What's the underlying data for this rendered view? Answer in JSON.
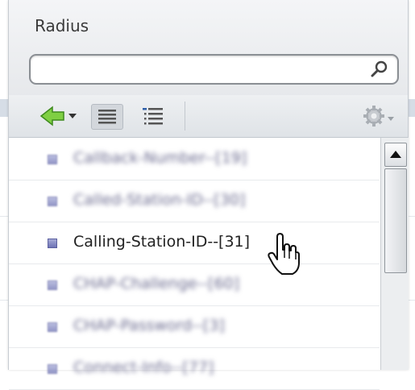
{
  "panel": {
    "title": "Radius"
  },
  "search": {
    "value": "",
    "placeholder": ""
  },
  "toolbar": {
    "back_icon": "green-left-arrow-icon",
    "list_view_icon": "list-view-icon",
    "tree_view_icon": "tree-view-icon",
    "gear_icon": "gear-icon"
  },
  "attributes": [
    {
      "label": "Callback-Number--[19]",
      "blurred": true
    },
    {
      "label": "Called-Station-ID--[30]",
      "blurred": true
    },
    {
      "label": "Calling-Station-ID--[31]",
      "blurred": false
    },
    {
      "label": "CHAP-Challenge--[60]",
      "blurred": true
    },
    {
      "label": "CHAP-Password--[3]",
      "blurred": true
    },
    {
      "label": "Connect-Info--[77]",
      "blurred": true
    }
  ],
  "colors": {
    "accent_green": "#5fb832",
    "bullet_purple": "#7e82c4"
  }
}
